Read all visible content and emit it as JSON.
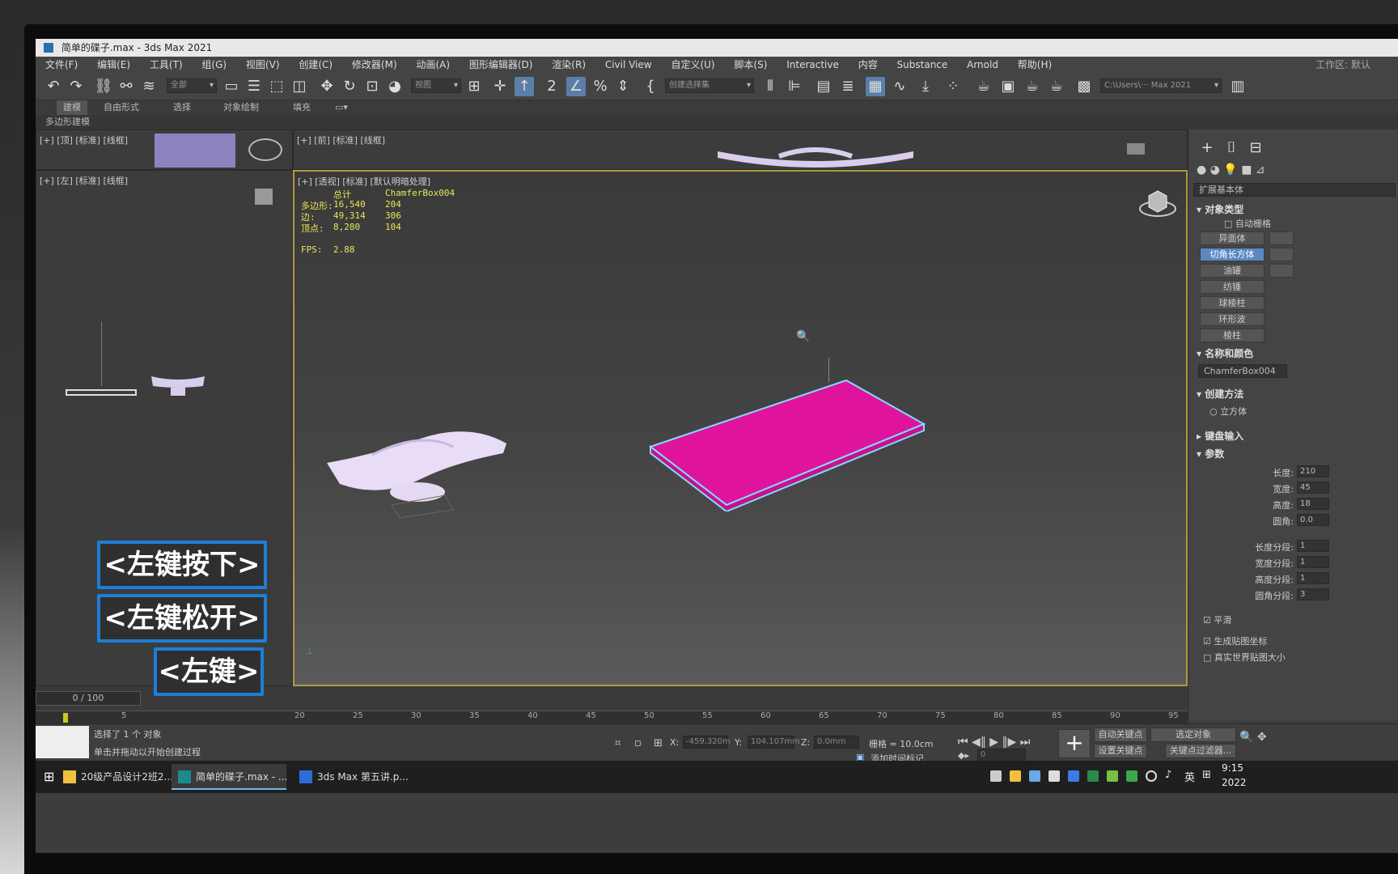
{
  "window": {
    "title": "简单的碟子.max - 3ds Max 2021",
    "workspace_label": "工作区: 默认"
  },
  "menu": [
    "文件(F)",
    "编辑(E)",
    "工具(T)",
    "组(G)",
    "视图(V)",
    "创建(C)",
    "修改器(M)",
    "动画(A)",
    "图形编辑器(D)",
    "渲染(R)",
    "Civil View",
    "自定义(U)",
    "脚本(S)",
    "Interactive",
    "内容",
    "Substance",
    "Arnold",
    "帮助(H)"
  ],
  "toolbar": {
    "selection_filter": "全部",
    "ref_coord": "视图",
    "named_selection": "创建选择集",
    "path": "C:\\Users\\··· Max 2021"
  },
  "ribbon": {
    "tabs": [
      "建模",
      "自由形式",
      "选择",
      "对象绘制",
      "填充"
    ],
    "active_tab": "建模",
    "sub_label": "多边形建模"
  },
  "viewports": {
    "top": {
      "label": "[+] [顶] [标准] [线框]"
    },
    "front": {
      "label": "[+] [前] [标准] [线框]"
    },
    "left": {
      "label": "[+] [左] [标准] [线框]"
    },
    "perspective": {
      "label": "[+] [透视] [标准] [默认明暗处理]",
      "stats": {
        "header_total": "总计",
        "header_object": "ChamferBox004",
        "rows": [
          {
            "name": "多边形:",
            "total": "16,540",
            "object": "204"
          },
          {
            "name": "边:",
            "total": "49,314",
            "object": "306"
          },
          {
            "name": "顶点:",
            "total": "8,280",
            "object": "104"
          }
        ],
        "fps_label": "FPS:",
        "fps_value": "2.88"
      }
    }
  },
  "command_panel": {
    "category": "扩展基本体",
    "object_type_title": "对象类型",
    "auto_grid": "自动栅格",
    "buttons": [
      "异面体",
      "切角长方体",
      "油罐",
      "纺锤",
      "球棱柱",
      "环形波",
      "棱柱"
    ],
    "active_button": "切角长方体",
    "name_color_title": "名称和颜色",
    "object_name": "ChamferBox004",
    "creation_method_title": "创建方法",
    "creation_method_option": "立方体",
    "keyboard_entry_title": "键盘输入",
    "params_title": "参数",
    "params": [
      {
        "label": "长度:",
        "value": "210"
      },
      {
        "label": "宽度:",
        "value": "45"
      },
      {
        "label": "高度:",
        "value": "18"
      },
      {
        "label": "圆角:",
        "value": "0.0"
      },
      {
        "label": "长度分段:",
        "value": "1"
      },
      {
        "label": "宽度分段:",
        "value": "1"
      },
      {
        "label": "高度分段:",
        "value": "1"
      },
      {
        "label": "圆角分段:",
        "value": "3"
      }
    ],
    "smooth_label": "平滑",
    "gen_map_coords": "生成贴图坐标",
    "real_world_map": "真实世界贴图大小"
  },
  "timeline": {
    "frame_display": "0 / 100",
    "ticks": [
      "5",
      "20",
      "25",
      "30",
      "35",
      "40",
      "45",
      "50",
      "55",
      "60",
      "65",
      "70",
      "75",
      "80",
      "85",
      "90",
      "95"
    ]
  },
  "status": {
    "selection": "选择了 1 个 对象",
    "prompt": "单击并拖动以开始创建过程",
    "x_label": "X:",
    "x_value": "-459.320m",
    "y_label": "Y:",
    "y_value": "104.107mm",
    "z_label": "Z:",
    "z_value": "0.0mm",
    "grid": "栅格 = 10.0cm",
    "add_time_tag": "添加时间标记",
    "auto_key": "自动关键点",
    "set_key": "设置关键点",
    "selected_object": "选定对象",
    "key_filters": "关键点过滤器...",
    "frame_value": "0"
  },
  "taskbar": {
    "items": [
      {
        "label": "20级产品设计2班2..."
      },
      {
        "label": "简单的碟子.max - ..."
      },
      {
        "label": "3ds Max 第五讲.p..."
      }
    ],
    "lang": "英",
    "time": "9:15",
    "date": "2022"
  },
  "key_hints": {
    "press": "<左键按下>",
    "release": "<左键松开>",
    "click": "<左键>"
  },
  "colors": {
    "chamfer_box": "#e0149c",
    "selection_outline": "#7fdcff",
    "active_viewport_border": "#b39a3c",
    "stats_text": "#e6e65a",
    "key_hint_border": "#1d7ed8"
  }
}
